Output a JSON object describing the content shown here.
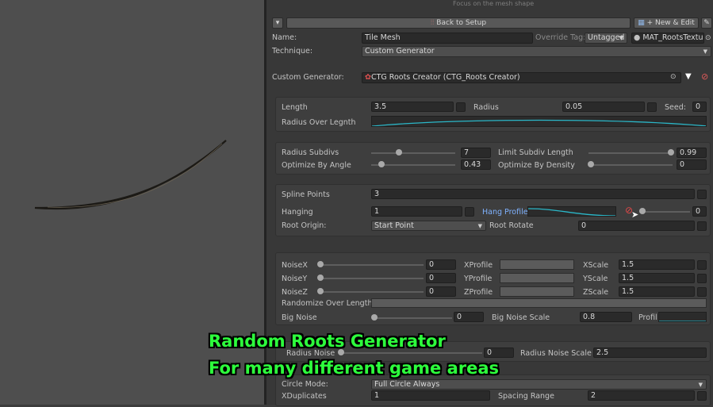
{
  "top_hint": "Focus on the mesh shape",
  "toolbar": {
    "collapse_glyph": "▾",
    "back_icon": "sliders-icon",
    "back_label": "Back to Setup",
    "new_icon": "grid-icon",
    "new_label": "+ New & Edit",
    "wrench_icon": "wrench-icon"
  },
  "header": {
    "name_label": "Name:",
    "name_value": "Tile Mesh",
    "override_tag_label": "Override Tag:",
    "override_tag_value": "Untagged",
    "material_value": "MAT_RootsTextur",
    "technique_label": "Technique:",
    "technique_value": "Custom Generator",
    "custom_generator_label": "Custom Generator:",
    "custom_generator_value": "CTG Roots Creator (CTG_Roots Creator)"
  },
  "section_a": {
    "length_label": "Length",
    "length_value": "3.5",
    "radius_label": "Radius",
    "radius_value": "0.05",
    "seed_label": "Seed:",
    "seed_value": "0",
    "radius_over_length_label": "Radius Over Legnth"
  },
  "section_b": {
    "radius_subdivs_label": "Radius Subdivs",
    "radius_subdivs_value": "7",
    "radius_subdivs_fraction": 0.33,
    "limit_subdiv_label": "Limit Subdiv Length",
    "limit_subdiv_value": "0.99",
    "limit_subdiv_fraction": 0.99,
    "optimize_angle_label": "Optimize By Angle",
    "optimize_angle_value": "0.43",
    "optimize_angle_fraction": 0.1,
    "optimize_density_label": "Optimize By Density",
    "optimize_density_value": "0",
    "optimize_density_fraction": 0.0
  },
  "section_c": {
    "spline_points_label": "Spline Points",
    "spline_points_value": "3",
    "hanging_label": "Hanging",
    "hanging_value": "1",
    "hang_profile_label": "Hang Profile",
    "hang_profile_value": "0",
    "root_origin_label": "Root Origin:",
    "root_origin_value": "Start Point",
    "root_rotate_label": "Root Rotate",
    "root_rotate_value": "0"
  },
  "section_d": {
    "noise_rows": [
      {
        "label": "NoiseX",
        "value": "0",
        "profile_label": "XProfile",
        "scale_label": "XScale",
        "scale_value": "1.5"
      },
      {
        "label": "NoiseY",
        "value": "0",
        "profile_label": "YProfile",
        "scale_label": "YScale",
        "scale_value": "1.5"
      },
      {
        "label": "NoiseZ",
        "value": "0",
        "profile_label": "ZProfile",
        "scale_label": "ZScale",
        "scale_value": "1.5"
      }
    ],
    "randomize_label": "Randomize Over Length",
    "big_noise_label": "Big Noise",
    "big_noise_value": "0",
    "big_noise_scale_label": "Big Noise Scale",
    "big_noise_scale_value": "0.8",
    "profil_label": "Profil"
  },
  "section_e": {
    "radius_noise_label": "Radius Noise",
    "radius_noise_value": "0",
    "radius_noise_scale_label": "Radius Noise Scale",
    "radius_noise_scale_value": "2.5"
  },
  "section_f": {
    "circle_mode_label": "Circle Mode:",
    "circle_mode_value": "Full Circle Always",
    "xduplicates_label": "XDuplicates",
    "xduplicates_value": "1",
    "spacing_range_label": "Spacing Range",
    "spacing_range_value": "2"
  },
  "overlay": {
    "line1": "Random Roots Generator",
    "line2": "For many different game areas"
  },
  "colors": {
    "curve": "#2bb7c8",
    "overlay_text": "#2dff3c",
    "hang_profile_label": "#7fb2ff"
  }
}
